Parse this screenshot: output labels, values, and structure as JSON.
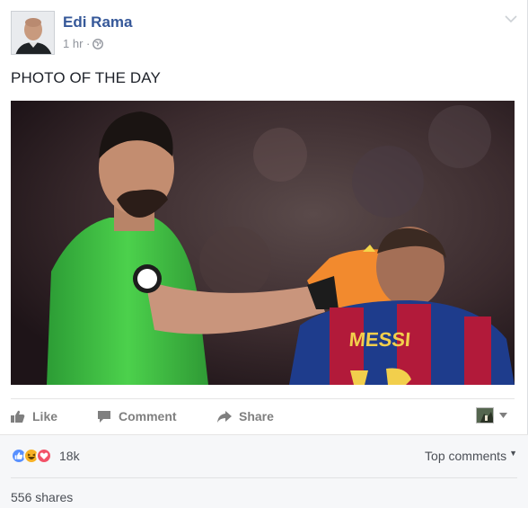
{
  "post": {
    "author": "Edi Rama",
    "timestamp": "1 hr ·",
    "privacy_icon": "globe-icon",
    "status_text": "PHOTO OF THE DAY",
    "photo": {
      "description_icon": "photo",
      "jersey_text": "MESSI"
    }
  },
  "actions": {
    "like": "Like",
    "comment": "Comment",
    "share": "Share"
  },
  "reactions": {
    "types": [
      "like",
      "haha",
      "love"
    ],
    "count": "18k",
    "top_comments": "Top comments"
  },
  "shares": "556 shares",
  "colors": {
    "author_blue": "#365899",
    "like_blue": "#5890ff",
    "haha_yellow": "#f7b125",
    "love_red": "#f25268",
    "muted_gray": "#90949c"
  }
}
